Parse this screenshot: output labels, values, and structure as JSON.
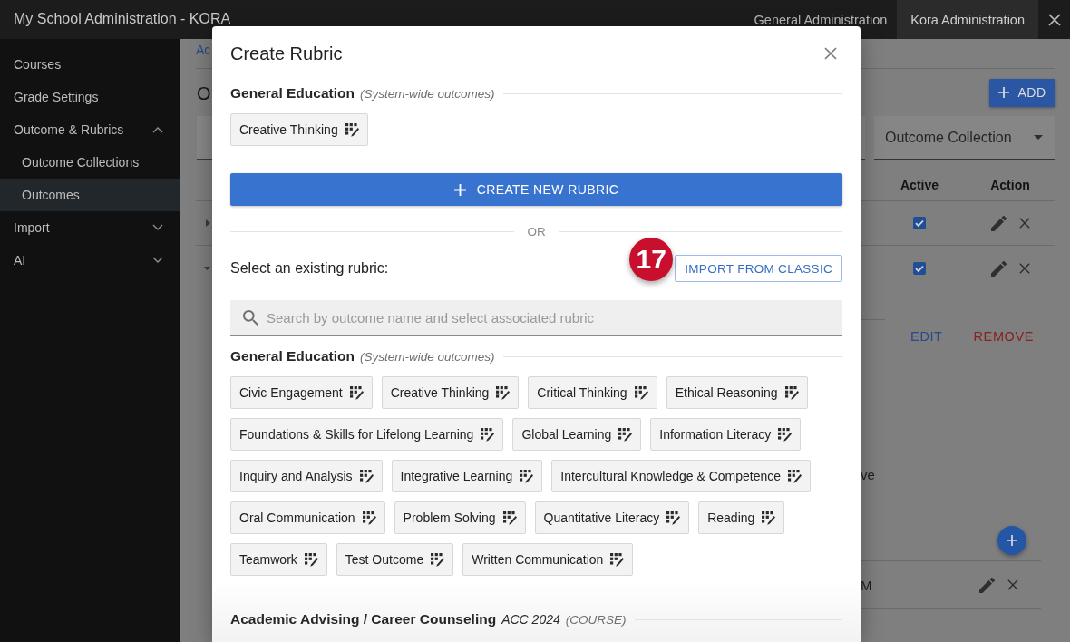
{
  "top_bar": {
    "title": "My School Administration - KORA",
    "tabs": [
      {
        "label": "General Administration",
        "selected": false
      },
      {
        "label": "Kora Administration",
        "selected": true
      }
    ]
  },
  "sidebar": {
    "items": [
      {
        "label": "Courses",
        "selected": false
      },
      {
        "label": "Grade Settings",
        "selected": false
      },
      {
        "label": "Outcome & Rubrics",
        "selected": false,
        "expanded": true,
        "children": [
          {
            "label": "Outcome Collections",
            "selected": false
          },
          {
            "label": "Outcomes",
            "selected": true
          }
        ]
      },
      {
        "label": "Import",
        "selected": false,
        "expanded": false
      },
      {
        "label": "AI",
        "selected": false,
        "expanded": false
      }
    ]
  },
  "page": {
    "breadcrumb": "Ac",
    "heading": "O",
    "add_button": "ADD",
    "collection_filter": {
      "label": "Outcome Collection"
    },
    "table": {
      "columns": [
        "Active",
        "Action"
      ],
      "rows": [
        {
          "expanded": false,
          "active": true
        },
        {
          "expanded": true,
          "active": true,
          "detail": {
            "actions": [
              {
                "label": "EDIT",
                "kind": "edit"
              },
              {
                "label": "REMOVE",
                "kind": "remove"
              }
            ],
            "text": "ve",
            "sub_rows": [
              {
                "text": "M"
              }
            ]
          }
        }
      ]
    }
  },
  "modal": {
    "title": "Create Rubric",
    "current": {
      "title": "General Education",
      "note": "(System-wide outcomes)",
      "chips": [
        "Creative Thinking"
      ]
    },
    "create_button": "CREATE NEW RUBRIC",
    "separator": "OR",
    "select_label": "Select an existing rubric:",
    "import_button": "IMPORT FROM CLASSIC",
    "step_badge": "17",
    "search": {
      "placeholder": "Search by outcome name and select associated rubric"
    },
    "groups": [
      {
        "title": "General Education",
        "note": "(System-wide outcomes)",
        "chips": [
          "Civic Engagement",
          "Creative Thinking",
          "Critical Thinking",
          "Ethical Reasoning",
          "Foundations & Skills for Lifelong Learning",
          "Global Learning",
          "Information Literacy",
          "Inquiry and Analysis",
          "Integrative Learning",
          "Intercultural Knowledge & Competence",
          "Oral Communication",
          "Problem Solving",
          "Quantitative Literacy",
          "Reading",
          "Teamwork",
          "Test Outcome",
          "Written Communication"
        ]
      },
      {
        "title": "Academic Advising / Career Counseling",
        "code": "ACC 2024",
        "note": "(COURSE)"
      }
    ]
  }
}
